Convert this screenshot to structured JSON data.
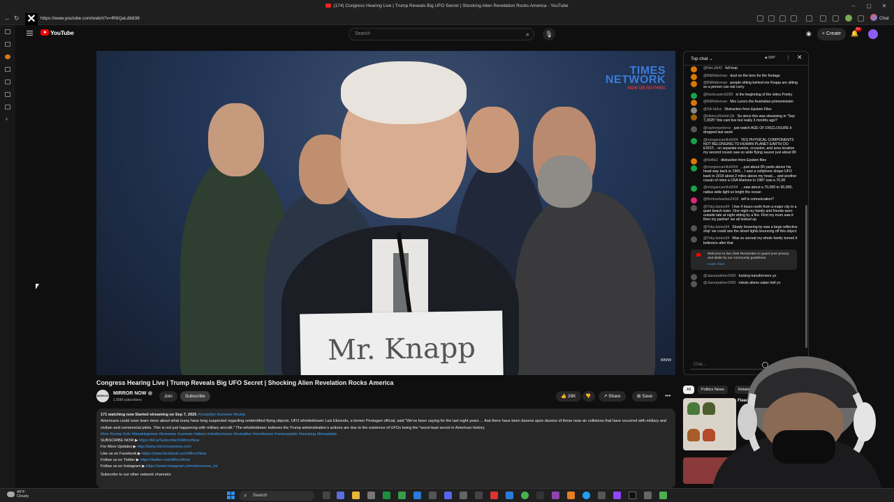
{
  "window": {
    "title": "(174) Congress Hearing Live | Trump Reveals Big UFO Secret | Shocking Alien Revelation Rocks America - YouTube",
    "url": "https://www.youtube.com/watch?v=lR6QaLdb838",
    "chat_button": "Chat"
  },
  "youtube": {
    "logo": "YouTube",
    "search_placeholder": "Search",
    "create_label": "Create",
    "notifications": "9+"
  },
  "video": {
    "overlay_logo_line1": "TIMES",
    "overlay_logo_line2": "NETWORK",
    "overlay_logo_line3": "NOW OR NOTHING",
    "nameplate": "Mr. Knapp",
    "watermark": "www",
    "title": "Congress Hearing Live | Trump Reveals Big UFO Secret | Shocking Alien Revelation Rocks America"
  },
  "channel": {
    "avatar_text": "MIRROR",
    "name": "MIRROR NOW",
    "subscribers": "1.99M subscribers",
    "join": "Join",
    "subscribe": "Subscribe",
    "likes": "28K",
    "share": "Share",
    "save": "Save"
  },
  "description": {
    "meta": "171 watching now  Started streaming on Sep 7, 2025",
    "meta_tags": "#trumplive #usnews #trump",
    "body": "Americans could soon learn more about what many have long suspected regarding unidentified flying objects. UFO whistleblower Luis Elizondo, a former Pentagon official, said \"We've been saying for the last eight years ... that there have been dozens upon dozens of these near-air collisions that have occurred with military and civilian and commercial pilots. This is not just happening with military aircraft.\" The whistleblower believes the Trump administration's actions are due to the existence of UFOs being the \"worst-kept secret in American history.",
    "tags": "#live #trump #ufo #breakingnews #livenews #usnews #aliens #ufodisclosure #trumplive #worldnews #newsupdate #breaking #liveupdate",
    "lines": [
      {
        "label": "SUBSCRIBE NOW ▶",
        "link": "https://bit.ly/SubscribeToMirrorNow"
      },
      {
        "label": "For More Updates ▶",
        "link": "http://www.mirrornownews.com"
      },
      {
        "label": "Like us on Facebook ▶",
        "link": "https://www.facebook.com/MirrorNow"
      },
      {
        "label": "Follow us on Twitter ▶",
        "link": "https://twitter.com/MirrorNow"
      },
      {
        "label": "Follow us on Instagram ▶",
        "link": "https://www.instagram.com/mirrornow_in/"
      }
    ],
    "footer": "Subscribe to our other network channels:"
  },
  "chat": {
    "header": "Top chat",
    "xp": "0XP",
    "input_placeholder": "Chat...",
    "messages": [
      {
        "author": "@NeLaN42",
        "text": "full loop",
        "color": "#d97706"
      },
      {
        "author": "@BillAlderman",
        "text": "dust on the lens for the footage",
        "color": "#d97706"
      },
      {
        "author": "@BillAlderman",
        "text": "people sitting behind me Knapp are sitting so a person can eat curry",
        "color": "#d97706"
      },
      {
        "author": "@frankcastro9289",
        "text": "is the beginning of the video.Poetry",
        "color": "#16a34a"
      },
      {
        "author": "@BillAlderman",
        "text": "Mrs Luna's the Australian primeminister",
        "color": "#d97706"
      },
      {
        "author": "@SA-fa9vz",
        "text": "Distraction from Epstein Files",
        "color": "#888888"
      },
      {
        "author": "@HistoryRetold-l2k",
        "text": "So since this was streaming in \"Sep 7,2025\" this cant live but really 3 months ago?",
        "color": "#a16207"
      },
      {
        "author": "@raylenepeterse",
        "text": "just watch AGE OF DISCLOSURE it dropped last week",
        "color": "#555555"
      },
      {
        "author": "@morgancarrillo6004",
        "text": "YES PHYSICAL COMPONENTS NOT BELONGING TO HUMAN PLANET EARTH DO EXIST... on separate events, occasion, and area location my second cousin saw so wide flying saucer just about 80",
        "color": "#16a34a"
      },
      {
        "author": "@Nefils2",
        "text": "distraction from Epstein files",
        "color": "#d97706"
      },
      {
        "author": "@morgancarrillo6004",
        "text": "...just about 80 yards above his head way back in 1965... I saw a cellphone shape UFO back in 2019 about 2 miles above my head.... and another cousin of mine a USA Marines in 1987 saw a 70,00",
        "color": "#16a34a"
      },
      {
        "author": "@morgancarrillo6004",
        "text": "...saw about a 70,000 to 90,000, radius wide light so bright the ocean",
        "color": "#16a34a"
      },
      {
        "author": "@florinsebastian2418",
        "text": "wtf is comunication?",
        "color": "#db2777"
      },
      {
        "author": "@TobyJames94",
        "text": "I live 4 hours north from a major city in a quiet beach town. One night my family and friends were outside late at night sitting by a fire. First my mum saw it then my partner' we all looked up",
        "color": "#555555"
      },
      {
        "author": "@TobyJames94",
        "text": "Slowly hovering by was a large reflective ship' we could see the street lights bouncing off this object",
        "color": "#555555"
      },
      {
        "author": "@TobyJames94",
        "text": "Was so surreal my whole family turned it believers after that",
        "color": "#555555"
      }
    ],
    "notice": "Welcome to live chat! Remember to guard your privacy and abide by our community guidelines.",
    "notice_link": "Learn more",
    "after_messages": [
      {
        "author": "@Jasonpalmer2000",
        "text": "fucking transformers yo",
        "color": "#555555"
      },
      {
        "author": "@Jasonpalmer2000",
        "text": "robots aliens satan hell yo",
        "color": "#555555"
      }
    ]
  },
  "recommendations": {
    "chips": [
      "All",
      "Politics News",
      "Related"
    ],
    "first_title": "Fleece Sh..."
  },
  "taskbar": {
    "temperature": "49°F",
    "condition": "Cloudy",
    "search": "Search"
  }
}
